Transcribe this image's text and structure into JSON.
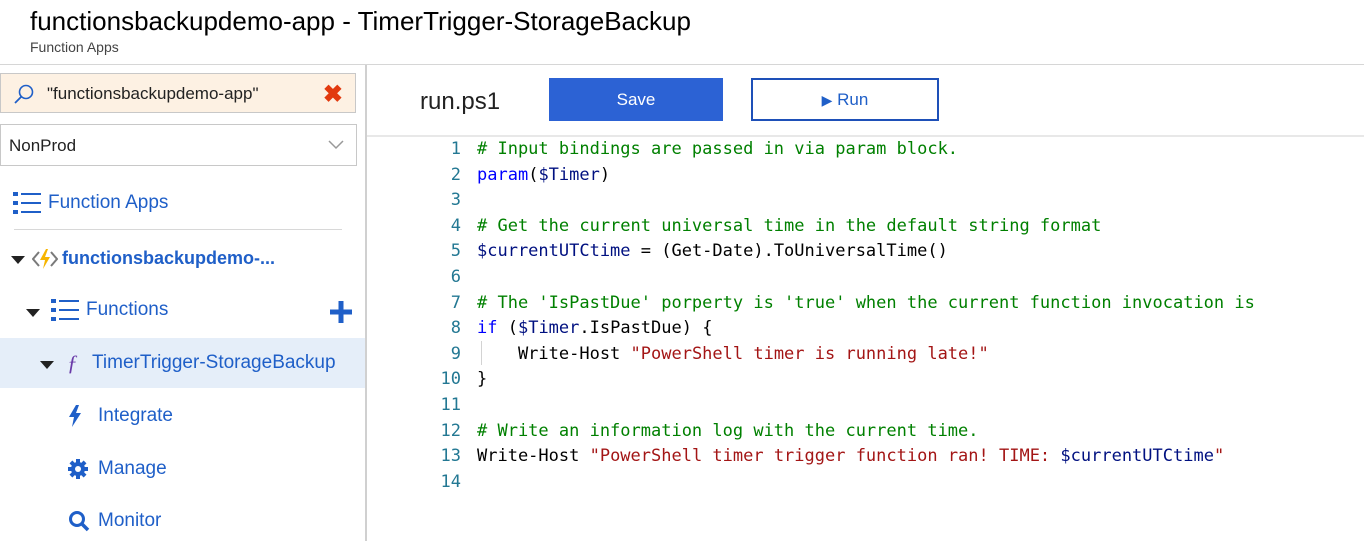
{
  "header": {
    "title": "functionsbackupdemo-app - TimerTrigger-StorageBackup",
    "subtitle": "Function Apps"
  },
  "sidebar": {
    "search": {
      "value": "\"functionsbackupdemo-app\"",
      "clear_icon": "close-icon"
    },
    "subscription_select": {
      "value": "NonProd"
    },
    "nav": {
      "function_apps": "Function Apps",
      "app_name": "functionsbackupdemo-...",
      "functions": "Functions",
      "function_name": "TimerTrigger-StorageBackup",
      "integrate": "Integrate",
      "manage": "Manage",
      "monitor": "Monitor"
    }
  },
  "editor": {
    "file_name": "run.ps1",
    "save_label": "Save",
    "run_label": "Run",
    "lines": [
      "# Input bindings are passed in via param block.",
      "param($Timer)",
      "",
      "# Get the current universal time in the default string format",
      "$currentUTCtime = (Get-Date).ToUniversalTime()",
      "",
      "# The 'IsPastDue' porperty is 'true' when the current function invocation is",
      "if ($Timer.IsPastDue) {",
      "    Write-Host \"PowerShell timer is running late!\"",
      "}",
      "",
      "# Write an information log with the current time.",
      "Write-Host \"PowerShell timer trigger function ran! TIME: $currentUTCtime\"",
      ""
    ]
  },
  "colors": {
    "accent": "#2c62d4",
    "link": "#1f5fc8",
    "comment": "#008000",
    "keyword": "#0000ff",
    "variable": "#001080",
    "string": "#a31515",
    "line_number": "#237893",
    "selected_bg": "#e5eef9",
    "search_bg": "#fdf1e3"
  }
}
